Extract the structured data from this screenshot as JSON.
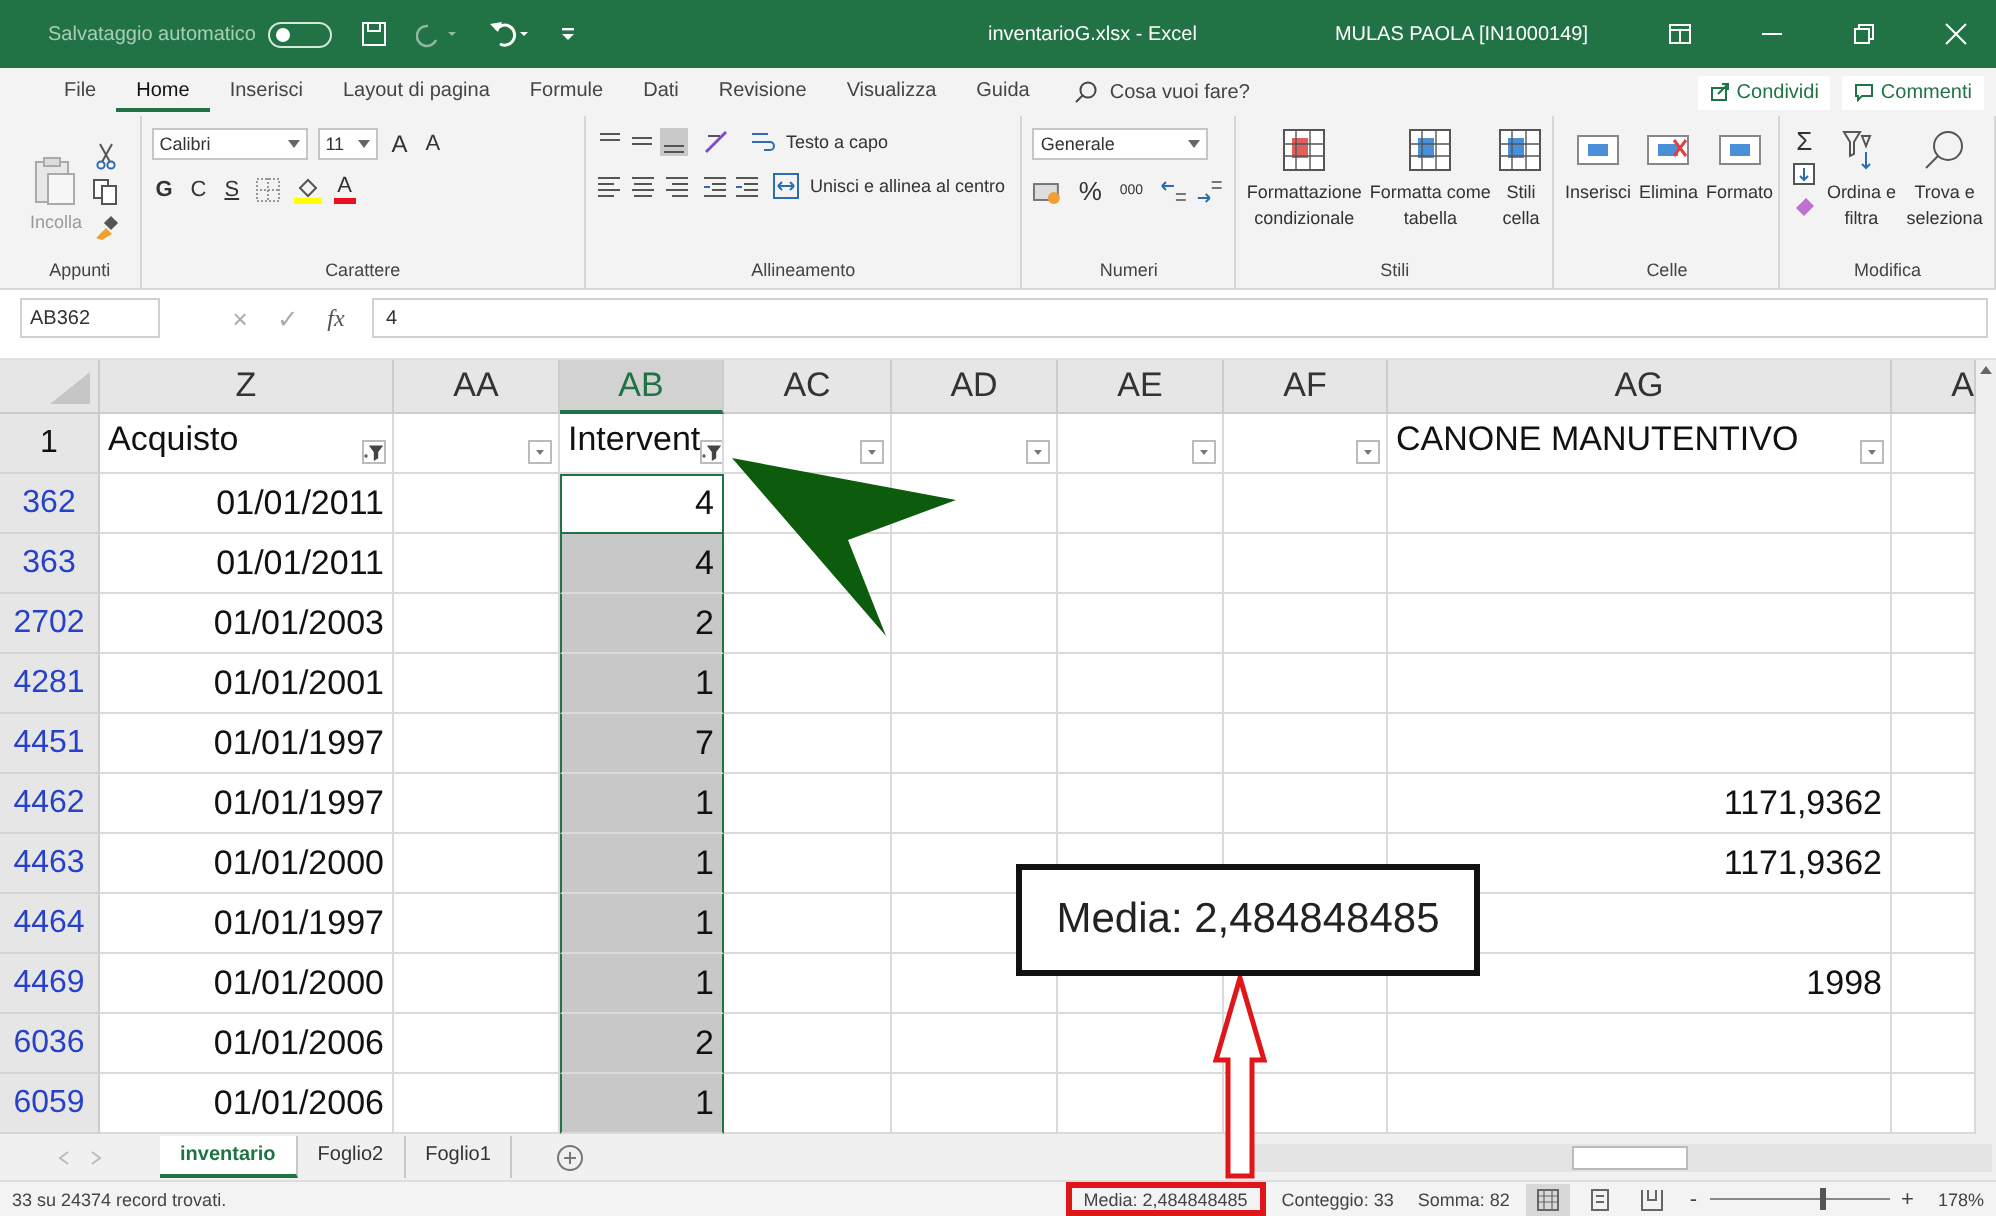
{
  "title_bar": {
    "autosave_label": "Salvataggio automatico",
    "autosave_on": false,
    "filename": "inventarioG.xlsx  -  Excel",
    "user": "MULAS PAOLA [IN1000149]"
  },
  "menu_tabs": [
    {
      "label": "File",
      "selected": false
    },
    {
      "label": "Home",
      "selected": true
    },
    {
      "label": "Inserisci",
      "selected": false
    },
    {
      "label": "Layout di pagina",
      "selected": false
    },
    {
      "label": "Formule",
      "selected": false
    },
    {
      "label": "Dati",
      "selected": false
    },
    {
      "label": "Revisione",
      "selected": false
    },
    {
      "label": "Visualizza",
      "selected": false
    },
    {
      "label": "Guida",
      "selected": false
    }
  ],
  "tell_me": "Cosa vuoi fare?",
  "share_button": "Condividi",
  "comments_button": "Commenti",
  "ribbon": {
    "clipboard": {
      "paste": "Incolla",
      "label": "Appunti"
    },
    "font": {
      "family": "Calibri",
      "size": "11",
      "grow": "A",
      "shrink": "A",
      "bold": "G",
      "italic": "C",
      "underline": "S",
      "font_color": "A",
      "label": "Carattere"
    },
    "alignment": {
      "wrap": "Testo a capo",
      "merge": "Unisci e allinea al centro",
      "label": "Allineamento"
    },
    "number": {
      "format": "Generale",
      "percent": "%",
      "thousands": "000",
      "label": "Numeri"
    },
    "styles": {
      "buttons": [
        {
          "lines": [
            "Formattazione",
            "condizionale"
          ]
        },
        {
          "lines": [
            "Formatta come",
            "tabella"
          ]
        },
        {
          "lines": [
            "Stili",
            "cella"
          ]
        }
      ],
      "label": "Stili"
    },
    "cells": {
      "buttons": [
        {
          "lines": [
            "Inserisci"
          ]
        },
        {
          "lines": [
            "Elimina"
          ]
        },
        {
          "lines": [
            "Formato"
          ]
        }
      ],
      "label": "Celle"
    },
    "editing": {
      "autosum": "Σ",
      "buttons": [
        {
          "lines": [
            "Ordina e",
            "filtra"
          ]
        },
        {
          "lines": [
            "Trova e",
            "seleziona"
          ]
        }
      ],
      "label": "Modifica"
    }
  },
  "formula_bar": {
    "name_box": "AB362",
    "cancel": "×",
    "enter": "✓",
    "function_label": "fx",
    "value": "4"
  },
  "grid": {
    "columns": [
      {
        "label": "Z",
        "selected": false
      },
      {
        "label": "AA",
        "selected": false
      },
      {
        "label": "AB",
        "selected": true
      },
      {
        "label": "AC",
        "selected": false
      },
      {
        "label": "AD",
        "selected": false
      },
      {
        "label": "AE",
        "selected": false
      },
      {
        "label": "AF",
        "selected": false
      },
      {
        "label": "AG",
        "selected": false
      },
      {
        "label": "A",
        "selected": false
      }
    ],
    "header_row": {
      "number": "1",
      "cells": [
        {
          "text": "Acquisto",
          "filtered": true
        },
        {
          "filtered": false
        },
        {
          "text": "Intervent",
          "filtered": true
        },
        {
          "filtered": false
        },
        {
          "filtered": false
        },
        {
          "filtered": false
        },
        {
          "filtered": false
        },
        {
          "text": "CANONE MANUTENTIVO",
          "filtered": false
        }
      ]
    },
    "rows": [
      {
        "number": "362",
        "Z": "01/01/2011",
        "AB": "4",
        "active": true
      },
      {
        "number": "363",
        "Z": "01/01/2011",
        "AB": "4",
        "active": false
      },
      {
        "number": "2702",
        "Z": "01/01/2003",
        "AB": "2",
        "active": false
      },
      {
        "number": "4281",
        "Z": "01/01/2001",
        "AB": "1",
        "active": false
      },
      {
        "number": "4451",
        "Z": "01/01/1997",
        "AB": "7",
        "active": false
      },
      {
        "number": "4462",
        "Z": "01/01/1997",
        "AB": "1",
        "AG": "1171,9362",
        "active": false
      },
      {
        "number": "4463",
        "Z": "01/01/2000",
        "AB": "1",
        "AG": "1171,9362",
        "active": false
      },
      {
        "number": "4464",
        "Z": "01/01/1997",
        "AB": "1",
        "active": false
      },
      {
        "number": "4469",
        "Z": "01/01/2000",
        "AB": "1",
        "AG": "1998",
        "active": false
      },
      {
        "number": "6036",
        "Z": "01/01/2006",
        "AB": "2",
        "active": false
      },
      {
        "number": "6059",
        "Z": "01/01/2006",
        "AB": "1",
        "active": false
      }
    ]
  },
  "sheet_tabs": [
    {
      "label": "inventario",
      "selected": true
    },
    {
      "label": "Foglio2",
      "selected": false
    },
    {
      "label": "Foglio1",
      "selected": false
    }
  ],
  "status_bar": {
    "message": "33 su 24374 record trovati.",
    "average": "Media: 2,484848485",
    "count": "Conteggio: 33",
    "sum": "Somma: 82",
    "zoom_out": "-",
    "zoom_in": "+",
    "zoom": {
      "level": 0.62
    },
    "zoom_label": "178%"
  },
  "callout": {
    "text": "Media: 2,484848485"
  }
}
